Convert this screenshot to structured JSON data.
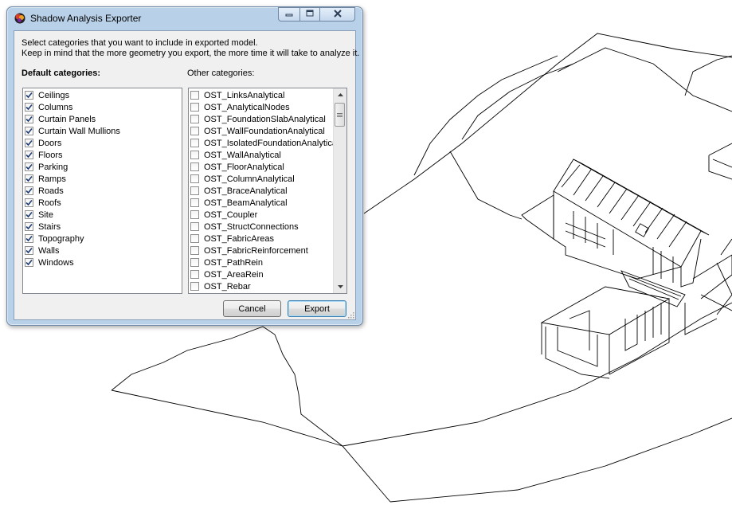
{
  "window": {
    "title": "Shadow Analysis Exporter"
  },
  "instructions": {
    "line1": "Select categories that you want to include in exported model.",
    "line2": "Keep in mind that the more geometry you export, the more time it will take to analyze it."
  },
  "default_categories": {
    "heading": "Default categories:",
    "items": [
      {
        "label": "Ceilings",
        "checked": true
      },
      {
        "label": "Columns",
        "checked": true
      },
      {
        "label": "Curtain Panels",
        "checked": true
      },
      {
        "label": "Curtain Wall Mullions",
        "checked": true
      },
      {
        "label": "Doors",
        "checked": true
      },
      {
        "label": "Floors",
        "checked": true
      },
      {
        "label": "Parking",
        "checked": true
      },
      {
        "label": "Ramps",
        "checked": true
      },
      {
        "label": "Roads",
        "checked": true
      },
      {
        "label": "Roofs",
        "checked": true
      },
      {
        "label": "Site",
        "checked": true
      },
      {
        "label": "Stairs",
        "checked": true
      },
      {
        "label": "Topography",
        "checked": true
      },
      {
        "label": "Walls",
        "checked": true
      },
      {
        "label": "Windows",
        "checked": true
      }
    ]
  },
  "other_categories": {
    "heading": "Other categories:",
    "items": [
      {
        "label": "OST_LinksAnalytical",
        "checked": false
      },
      {
        "label": "OST_AnalyticalNodes",
        "checked": false
      },
      {
        "label": "OST_FoundationSlabAnalytical",
        "checked": false
      },
      {
        "label": "OST_WallFoundationAnalytical",
        "checked": false
      },
      {
        "label": "OST_IsolatedFoundationAnalytical",
        "checked": false
      },
      {
        "label": "OST_WallAnalytical",
        "checked": false
      },
      {
        "label": "OST_FloorAnalytical",
        "checked": false
      },
      {
        "label": "OST_ColumnAnalytical",
        "checked": false
      },
      {
        "label": "OST_BraceAnalytical",
        "checked": false
      },
      {
        "label": "OST_BeamAnalytical",
        "checked": false
      },
      {
        "label": "OST_Coupler",
        "checked": false
      },
      {
        "label": "OST_StructConnections",
        "checked": false
      },
      {
        "label": "OST_FabricAreas",
        "checked": false
      },
      {
        "label": "OST_FabricReinforcement",
        "checked": false
      },
      {
        "label": "OST_PathRein",
        "checked": false
      },
      {
        "label": "OST_AreaRein",
        "checked": false
      },
      {
        "label": "OST_Rebar",
        "checked": false
      }
    ]
  },
  "buttons": {
    "cancel": "Cancel",
    "export": "Export"
  },
  "icons": {
    "app": "app-logo-icon",
    "minimize": "minimize-icon",
    "maximize": "maximize-icon",
    "close": "close-icon",
    "scroll_up": "scroll-up-arrow-icon",
    "scroll_down": "scroll-down-arrow-icon",
    "size_grip": "resize-grip-icon"
  },
  "colors": {
    "frame": "#b8d0e8",
    "client": "#f0f0f0",
    "check": "#1f3e74",
    "default_button_border": "#3c7fb1"
  }
}
